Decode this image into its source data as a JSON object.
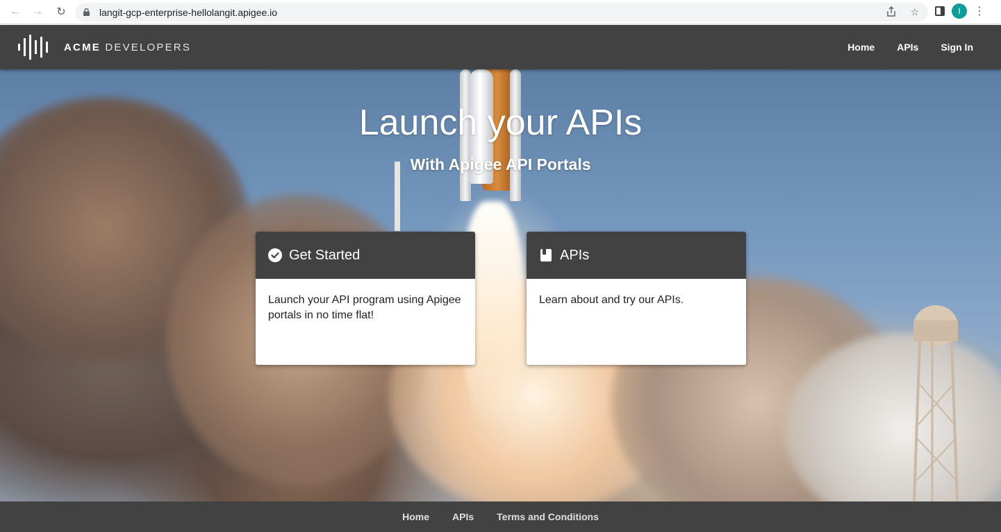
{
  "browser": {
    "url": "langit-gcp-enterprise-hellolangit.apigee.io",
    "avatar_letter": "I",
    "avatar_color": "#0f9d9a"
  },
  "header": {
    "brand_bold": "ACME",
    "brand_rest": " DEVELOPERS",
    "nav": [
      "Home",
      "APIs",
      "Sign In"
    ]
  },
  "hero": {
    "title": "Launch your APIs",
    "subtitle": "With Apigee API Portals"
  },
  "cards": [
    {
      "icon": "check-circle-icon",
      "title": "Get Started",
      "description": "Launch your API program using Apigee portals in no time flat!"
    },
    {
      "icon": "book-icon",
      "title": "APIs",
      "description": "Learn about and try our APIs."
    }
  ],
  "footer": {
    "links": [
      "Home",
      "APIs",
      "Terms and Conditions"
    ]
  },
  "colors": {
    "header_bg": "#424242",
    "footer_bg": "#424242",
    "card_head_bg": "#424242"
  }
}
